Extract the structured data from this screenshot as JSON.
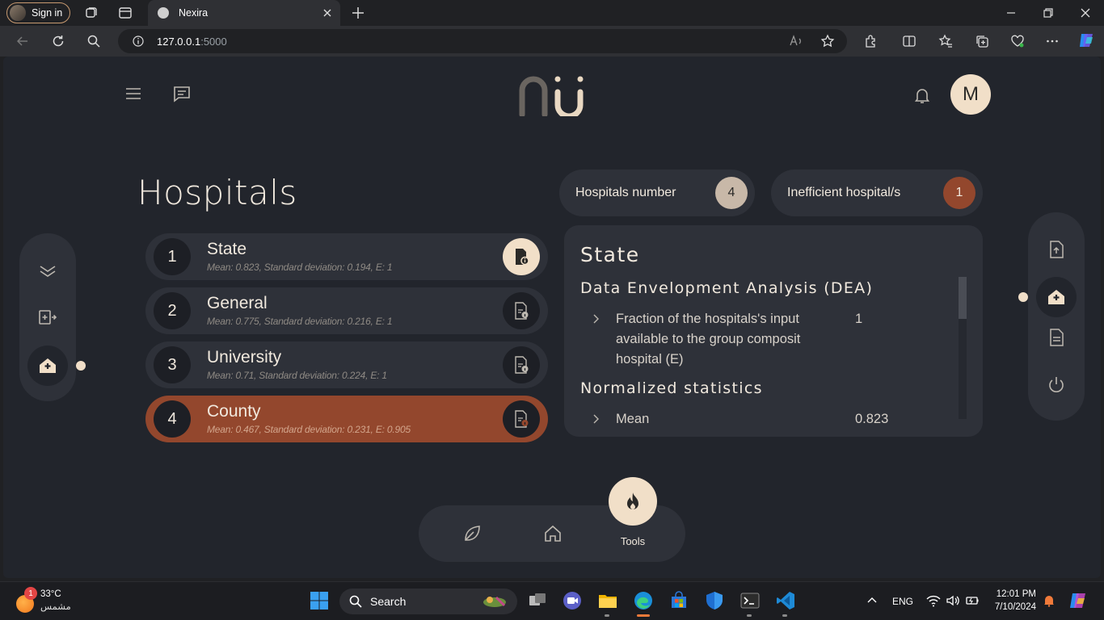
{
  "browser": {
    "signin_label": "Sign in",
    "tab_title": "Nexira",
    "url_host": "127.0.0.1",
    "url_port": ":5000"
  },
  "app": {
    "page_title": "Hospitals",
    "avatar_letter": "M",
    "stats": [
      {
        "label": "Hospitals number",
        "value": "4",
        "color": "#c8b8a8"
      },
      {
        "label": "Inefficient hospital/s",
        "value": "1",
        "color": "#93472d"
      }
    ],
    "hospitals": [
      {
        "index": "1",
        "name": "State",
        "meta": "Mean: 0.823, Standard deviation: 0.194, E: 1"
      },
      {
        "index": "2",
        "name": "General",
        "meta": "Mean: 0.775, Standard deviation: 0.216, E: 1"
      },
      {
        "index": "3",
        "name": "University",
        "meta": "Mean: 0.71, Standard deviation: 0.224, E: 1"
      },
      {
        "index": "4",
        "name": "County",
        "meta": "Mean: 0.467, Standard deviation: 0.231, E: 0.905"
      }
    ],
    "detail": {
      "title": "State",
      "section1": "Data Envelopment Analysis (DEA)",
      "row1_label": "Fraction of the hospitals's input available to the group composit hospital (E)",
      "row1_value": "1",
      "section2": "Normalized statistics",
      "row2_label": "Mean",
      "row2_value": "0.823"
    },
    "tools_label": "Tools",
    "accent_color": "#93472d",
    "cream_color": "#f1dfc8"
  },
  "taskbar": {
    "temperature": "33°C",
    "weather_text": "مشمس",
    "weather_badge": "1",
    "search_label": "Search",
    "language": "ENG",
    "time": "12:01 PM",
    "date": "7/10/2024"
  }
}
